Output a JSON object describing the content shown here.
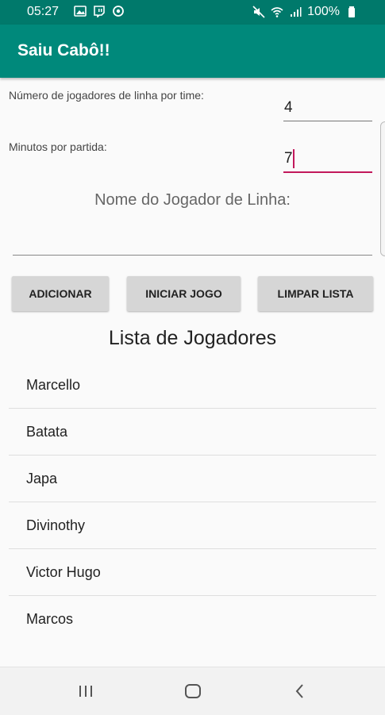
{
  "status_bar": {
    "time": "05:27",
    "battery": "100%"
  },
  "app_bar": {
    "title": "Saiu Cabô!!"
  },
  "form": {
    "players_per_team_label": "Número de jogadores de linha por time:",
    "players_per_team_value": "4",
    "minutes_label": "Minutos por partida:",
    "minutes_value": "7",
    "player_name_hint": "Nome do Jogador de Linha:"
  },
  "buttons": {
    "add": "ADICIONAR",
    "start": "INICIAR JOGO",
    "clear": "LIMPAR LISTA"
  },
  "list": {
    "title": "Lista de Jogadores",
    "players": [
      "Marcello",
      "Batata",
      "Japa",
      "Divinothy",
      "Victor Hugo",
      "Marcos"
    ]
  },
  "colors": {
    "status_bar": "#00796b",
    "app_bar": "#00897b",
    "accent": "#c2185b"
  }
}
